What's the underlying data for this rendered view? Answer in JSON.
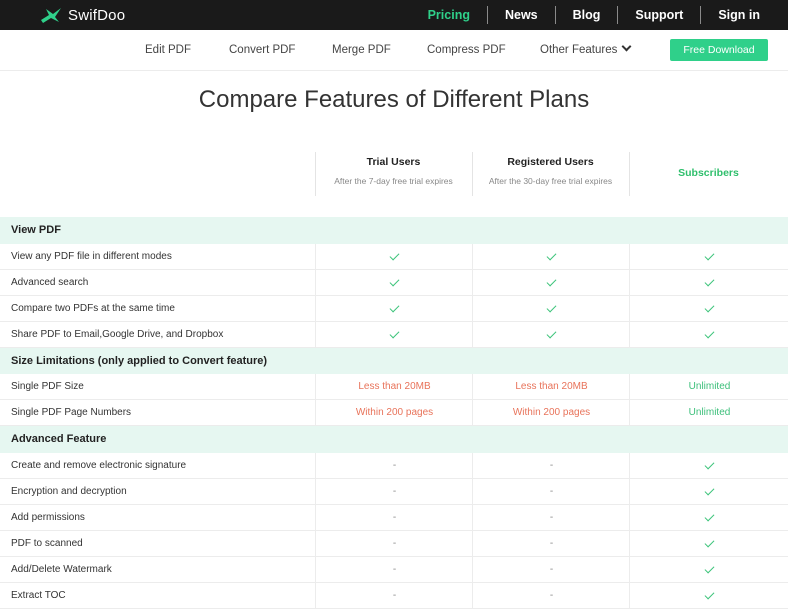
{
  "brand": {
    "name": "SwifDoo"
  },
  "topnav": [
    "Pricing",
    "News",
    "Blog",
    "Support",
    "Sign in"
  ],
  "subnav": {
    "links": [
      "Edit PDF",
      "Convert PDF",
      "Merge PDF",
      "Compress PDF",
      "Other Features"
    ],
    "download": "Free Download"
  },
  "title": "Compare Features of Different Plans",
  "plans": [
    {
      "name": "Trial Users",
      "desc": "After the 7-day free trial expires"
    },
    {
      "name": "Registered Users",
      "desc": "After the 30-day free trial expires"
    },
    {
      "name": "Subscribers",
      "desc": ""
    }
  ],
  "sections": [
    {
      "title": "View PDF",
      "rows": [
        {
          "label": "View any PDF file in different modes",
          "values": [
            "check",
            "check",
            "check"
          ]
        },
        {
          "label": "Advanced search",
          "values": [
            "check",
            "check",
            "check"
          ]
        },
        {
          "label": "Compare two PDFs at the same time",
          "values": [
            "check",
            "check",
            "check"
          ]
        },
        {
          "label": "Share PDF to Email,Google Drive, and Dropbox",
          "values": [
            "check",
            "check",
            "check"
          ]
        }
      ]
    },
    {
      "title": "Size Limitations (only applied to Convert feature)",
      "rows": [
        {
          "label": "Single PDF Size",
          "values": [
            "Less than 20MB",
            "Less than 20MB",
            "Unlimited"
          ]
        },
        {
          "label": "Single PDF Page Numbers",
          "values": [
            "Within 200 pages",
            "Within 200 pages",
            "Unlimited"
          ]
        }
      ]
    },
    {
      "title": "Advanced Feature",
      "rows": [
        {
          "label": "Create and remove electronic signature",
          "values": [
            "-",
            "-",
            "check"
          ]
        },
        {
          "label": "Encryption and decryption",
          "values": [
            "-",
            "-",
            "check"
          ]
        },
        {
          "label": "Add permissions",
          "values": [
            "-",
            "-",
            "check"
          ]
        },
        {
          "label": "PDF to scanned",
          "values": [
            "-",
            "-",
            "check"
          ]
        },
        {
          "label": "Add/Delete Watermark",
          "values": [
            "-",
            "-",
            "check"
          ]
        },
        {
          "label": "Extract TOC",
          "values": [
            "-",
            "-",
            "check"
          ]
        }
      ]
    }
  ],
  "colors": {
    "accent": "#2fd08a",
    "limit": "#e8735a",
    "unlimited": "#3cbf7a",
    "section_bg": "#e6f7f1"
  }
}
